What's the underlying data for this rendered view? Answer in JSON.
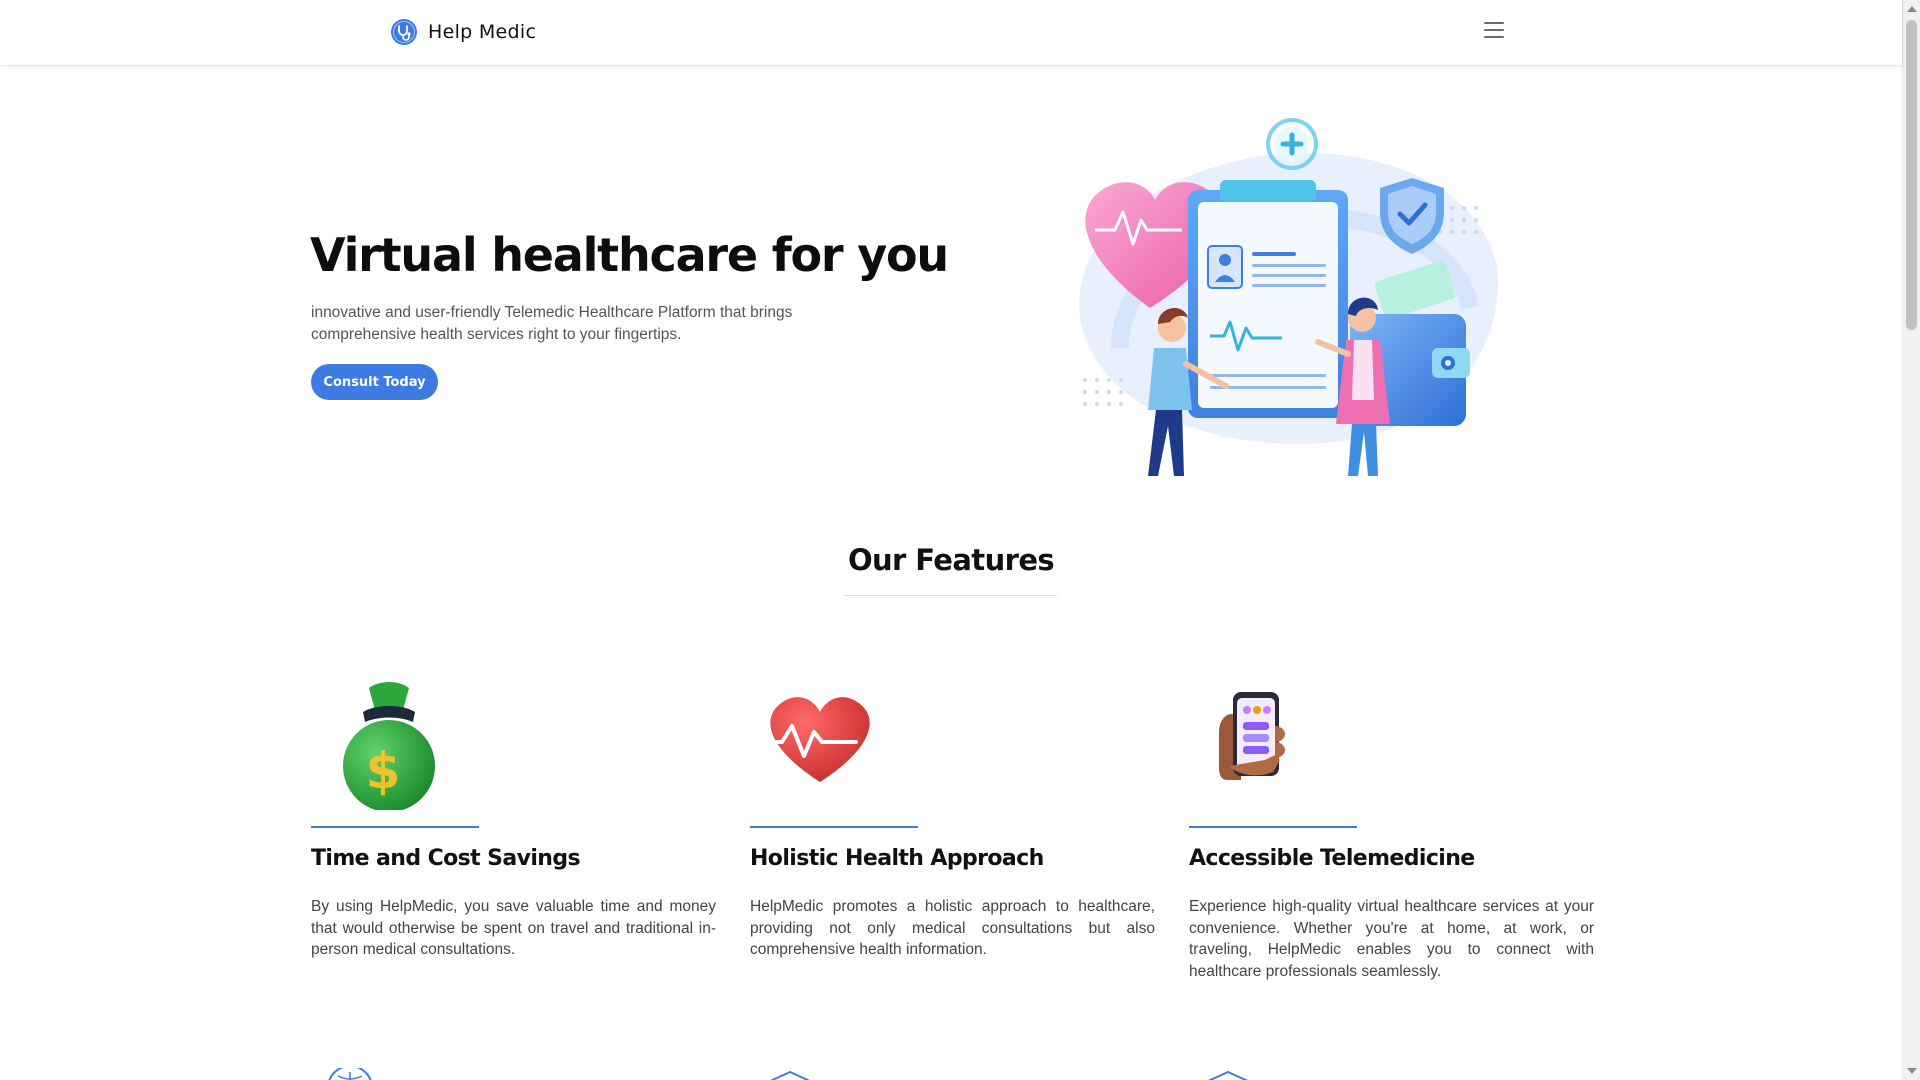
{
  "header": {
    "brand_name": "Help Medic",
    "menu_icon": "hamburger-menu-icon"
  },
  "hero": {
    "title": "Virtual healthcare for you",
    "description": "innovative and user-friendly Telemedic Healthcare Platform that brings comprehensive health services right to your fingertips.",
    "cta_label": "Consult Today",
    "illustration": "medical-clipboard-doctors-illustration"
  },
  "features": {
    "title": "Our Features",
    "items": [
      {
        "icon": "money-bag-icon",
        "title": "Time and Cost Savings",
        "description": "By using HelpMedic, you save valuable time and money that would otherwise be spent on travel and traditional in-person medical consultations."
      },
      {
        "icon": "heart-pulse-icon",
        "title": "Holistic Health Approach",
        "description": "HelpMedic promotes a holistic approach to healthcare, providing not only medical consultations but also comprehensive health information."
      },
      {
        "icon": "phone-in-hand-icon",
        "title": "Accessible Telemedicine",
        "description": "Experience high-quality virtual healthcare services at your convenience. Whether you're at home, at work, or traveling, HelpMedic enables you to connect with healthcare professionals seamlessly."
      }
    ]
  },
  "colors": {
    "accent": "#3d7be3",
    "heading": "#111111",
    "body_text": "#555555"
  }
}
